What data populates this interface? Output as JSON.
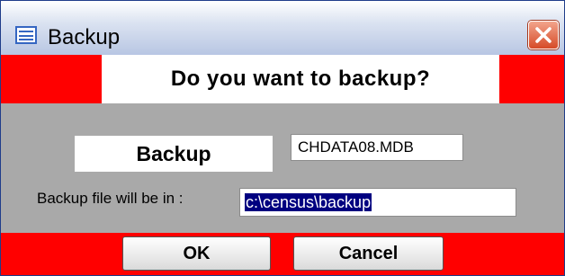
{
  "window": {
    "title": "Backup",
    "icon": "form-icon",
    "close_icon": "close-icon",
    "colors": {
      "band": "#ff0000",
      "body": "#a9a9a9",
      "close": "#d64a27"
    }
  },
  "dialog": {
    "question": "Do you want to backup?",
    "backup_label": "Backup",
    "database_file": "CHDATA08.MDB",
    "location_label": "Backup file will be in :",
    "location_value": "c:\\census\\backup"
  },
  "buttons": {
    "ok": "OK",
    "cancel": "Cancel"
  }
}
